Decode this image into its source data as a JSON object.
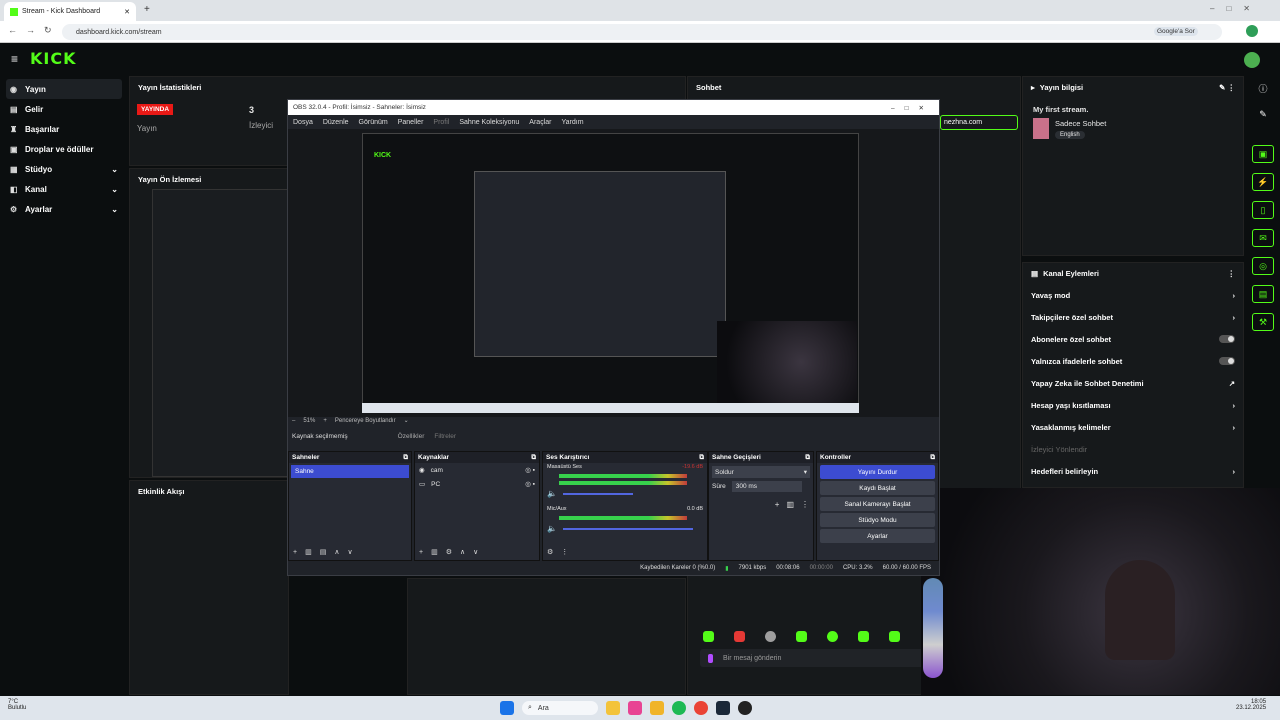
{
  "browser": {
    "tab_title": "Stream - Kick Dashboard",
    "url": "dashboard.kick.com/stream",
    "google_label": "Google'a Sor"
  },
  "kick": {
    "logo": "KICK"
  },
  "sidebar": {
    "items": [
      {
        "label": "Yayın",
        "icon": "broadcast-icon"
      },
      {
        "label": "Gelir",
        "icon": "money-icon"
      },
      {
        "label": "Başarılar",
        "icon": "trophy-icon"
      },
      {
        "label": "Droplar ve ödüller",
        "icon": "gift-icon"
      },
      {
        "label": "Stüdyo",
        "icon": "studio-icon"
      },
      {
        "label": "Kanal",
        "icon": "channel-icon"
      },
      {
        "label": "Ayarlar",
        "icon": "gear-icon"
      }
    ]
  },
  "stats": {
    "title": "Yayın İstatistikleri",
    "live_badge": "YAYINDA",
    "stream_label": "Yayın",
    "viewers": "3",
    "viewers_label": "İzleyici"
  },
  "preview_panel": {
    "title": "Yayın Ön İzlemesi"
  },
  "activity": {
    "title": "Etkinlik Akışı"
  },
  "chat": {
    "title": "Sohbet",
    "link": "nezhna.com",
    "placeholder": "Bir mesaj gönderin"
  },
  "info": {
    "title": "Yayın bilgisi",
    "stream_title": "My first stream.",
    "category": "Sadece Sohbet",
    "language": "English"
  },
  "actions": {
    "title": "Kanal Eylemleri",
    "items": [
      {
        "label": "Yavaş mod",
        "type": "arrow"
      },
      {
        "label": "Takipçilere özel sohbet",
        "type": "arrow"
      },
      {
        "label": "Abonelere özel sohbet",
        "type": "toggle"
      },
      {
        "label": "Yalnızca ifadelerle sohbet",
        "type": "toggle"
      },
      {
        "label": "Yapay Zeka ile Sohbet Denetimi",
        "type": "link"
      },
      {
        "label": "Hesap yaşı kısıtlaması",
        "type": "arrow"
      },
      {
        "label": "Yasaklanmış kelimeler",
        "type": "arrow"
      },
      {
        "label": "İzleyici Yönlendir",
        "type": "disabled"
      },
      {
        "label": "Hedefleri belirleyin",
        "type": "arrow"
      }
    ]
  },
  "obs": {
    "title": "OBS 32.0.4 - Profil: İsimsiz - Sahneler: İsimsiz",
    "menu": [
      "Dosya",
      "Düzenle",
      "Görünüm",
      "Paneller",
      "Profil",
      "Sahne Koleksiyonu",
      "Araçlar",
      "Yardım"
    ],
    "zoom": "51%",
    "resize": "Pencereye Boyutlandır",
    "no_source": "Kaynak seçilmemiş",
    "props": "Özellikler",
    "filters": "Filtreler",
    "scenes_title": "Sahneler",
    "scene": "Sahne",
    "sources_title": "Kaynaklar",
    "sources": [
      "cam",
      "PC"
    ],
    "mixer_title": "Ses Karıştırıcı",
    "desktop": "Masaüstü Ses",
    "desktop_db": "-19.6 dB",
    "mic": "Mic/Aux",
    "mic_db": "0.0 dB",
    "transitions_title": "Sahne Geçişleri",
    "transition": "Soldur",
    "duration_label": "Süre",
    "duration": "300 ms",
    "controls_title": "Kontroller",
    "controls": [
      "Yayını Durdur",
      "Kaydı Başlat",
      "Sanal Kamerayı Başlat",
      "Stüdyo Modu",
      "Ayarlar"
    ],
    "status": {
      "dropped": "Kaybedilen Kareler 0 (%0.0)",
      "bitrate": "7901 kbps",
      "stream_time": "00:08:06",
      "rec_time": "00:00:00",
      "cpu": "CPU: 3.2%",
      "fps": "60.00 / 60.00 FPS"
    }
  },
  "taskbar": {
    "weather_temp": "7°C",
    "weather_desc": "Bulutlu",
    "search": "Ara",
    "time": "18:05",
    "date": "23.12.2025"
  }
}
